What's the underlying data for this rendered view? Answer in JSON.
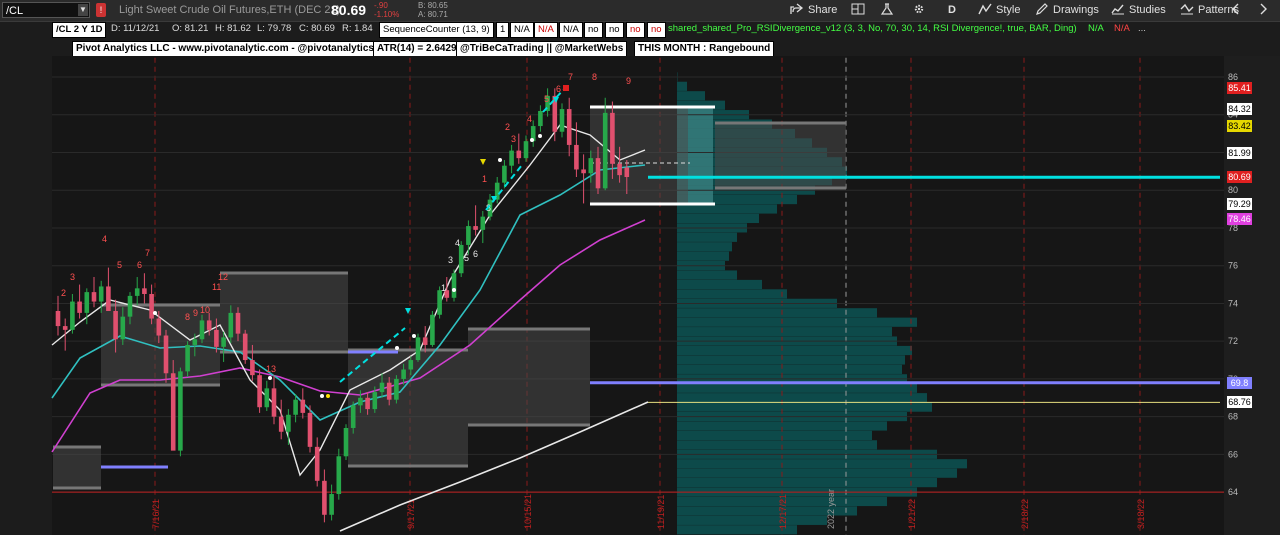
{
  "toolbar": {
    "symbol": "/CL",
    "description": "Light Sweet Crude Oil Futures,ETH (DEC 21)",
    "last": "80.69",
    "change_net": "-.90",
    "change_pct": "-1.10%",
    "bid": "B: 80.65",
    "ask": "A: 80.71",
    "share": "Share",
    "style": "Style",
    "drawings": "Drawings",
    "studies": "Studies",
    "patterns": "Patterns",
    "period": "D"
  },
  "header": {
    "period_label": "/CL 2 Y 1D",
    "date": "D: 11/12/21",
    "open": "O: 81.21",
    "high": "H: 81.62",
    "low": "L: 79.78",
    "close": "C: 80.69",
    "range": "R: 1.84",
    "seq_counter": "SequenceCounter (13, 9)",
    "seq_1": "1",
    "na1": "N/A",
    "na2": "N/A",
    "na3": "N/A",
    "no1": "no",
    "no2": "no",
    "no3": "no",
    "no4": "no",
    "rsi_study": "shared_shared_Pro_RSIDivergence_v12 (3, 3, No, 70, 30, 14, RSI Divergence!, true, BAR, Ding)",
    "rsi_na1": "N/A",
    "rsi_na2": "N/A",
    "ellipsis": "..."
  },
  "labels": {
    "brand": "Pivot Analytics LLC - www.pivotanalytic.com - @pivotanalytics",
    "atr": "ATR(14) = 2.6429",
    "social": "@TriBeCaTrading || @MarketWebs",
    "month": "THIS MONTH : Rangebound"
  },
  "price_axis": {
    "ticks": [
      "86",
      "84",
      "82",
      "80",
      "78",
      "76",
      "74",
      "72",
      "70",
      "68",
      "66",
      "64"
    ],
    "markers": [
      {
        "label": "85.41",
        "color": "#e02020"
      },
      {
        "label": "84.32",
        "color": "#ffffff"
      },
      {
        "label": "83.42",
        "color": "#e6d800"
      },
      {
        "label": "81.99",
        "color": "#ffffff"
      },
      {
        "label": "80.69",
        "color": "#e02020"
      },
      {
        "label": "79.29",
        "color": "#ffffff"
      },
      {
        "label": "78.46",
        "color": "#e040e0"
      },
      {
        "label": "69.8",
        "color": "#8080ff"
      },
      {
        "label": "68.76",
        "color": "#ffffff"
      }
    ]
  },
  "date_labels": [
    "7/16/21",
    "9/17/21",
    "10/15/21",
    "11/19/21",
    "12/17/21",
    "2022 year",
    "1/21/22",
    "2/18/22",
    "3/18/22"
  ],
  "sequence_marks": {
    "green": [
      "1",
      "2",
      "3",
      "4",
      "5",
      "6",
      "7",
      "8",
      "9"
    ],
    "red": [
      "2",
      "3",
      "4",
      "5",
      "6",
      "7",
      "8",
      "9",
      "10",
      "11",
      "12",
      "13"
    ]
  },
  "chart_data": {
    "type": "candlestick",
    "ylim": [
      62,
      87.5
    ],
    "horizontal_lines": [
      {
        "value": 64,
        "color": "#c02020"
      },
      {
        "value": 80.69,
        "color": "#00e0e0"
      },
      {
        "value": 69.8,
        "color": "#8080ff"
      }
    ],
    "candles": [
      [
        73.6,
        74.4,
        72.3,
        72.8
      ],
      [
        72.8,
        73.2,
        71.5,
        72.6
      ],
      [
        72.6,
        74.5,
        72.4,
        74.1
      ],
      [
        74.1,
        75.0,
        73.2,
        73.5
      ],
      [
        73.5,
        74.8,
        72.9,
        74.6
      ],
      [
        74.6,
        75.4,
        73.8,
        74.1
      ],
      [
        74.1,
        75.2,
        73.5,
        74.9
      ],
      [
        74.9,
        75.9,
        74.2,
        73.6
      ],
      [
        73.6,
        74.2,
        71.4,
        72.1
      ],
      [
        72.1,
        73.8,
        71.8,
        73.3
      ],
      [
        73.3,
        74.6,
        72.9,
        74.4
      ],
      [
        74.4,
        75.4,
        73.9,
        74.8
      ],
      [
        74.8,
        75.6,
        74.0,
        74.5
      ],
      [
        74.5,
        75.0,
        72.9,
        73.2
      ],
      [
        73.2,
        73.6,
        71.9,
        72.3
      ],
      [
        72.3,
        72.6,
        69.8,
        70.3
      ],
      [
        70.3,
        71.0,
        67.0,
        66.2
      ],
      [
        66.2,
        70.6,
        65.9,
        70.4
      ],
      [
        70.4,
        72.0,
        70.1,
        71.8
      ],
      [
        71.8,
        72.4,
        71.2,
        72.1
      ],
      [
        72.1,
        73.4,
        71.9,
        73.1
      ],
      [
        73.1,
        73.5,
        72.3,
        72.6
      ],
      [
        72.6,
        73.2,
        71.4,
        71.7
      ],
      [
        71.7,
        72.5,
        70.9,
        72.2
      ],
      [
        72.2,
        73.9,
        71.9,
        73.5
      ],
      [
        73.5,
        73.8,
        72.0,
        72.4
      ],
      [
        72.4,
        72.6,
        70.8,
        71.0
      ],
      [
        71.0,
        71.8,
        69.9,
        70.2
      ],
      [
        70.2,
        70.5,
        68.2,
        68.5
      ],
      [
        68.5,
        69.9,
        68.3,
        69.5
      ],
      [
        69.5,
        70.2,
        67.6,
        68.0
      ],
      [
        68.0,
        68.9,
        66.8,
        67.2
      ],
      [
        67.2,
        68.4,
        66.5,
        68.1
      ],
      [
        68.1,
        69.2,
        67.7,
        68.9
      ],
      [
        68.9,
        69.5,
        67.9,
        68.2
      ],
      [
        68.2,
        68.6,
        66.1,
        66.4
      ],
      [
        66.4,
        66.9,
        64.3,
        64.6
      ],
      [
        64.6,
        65.2,
        62.4,
        62.8
      ],
      [
        62.8,
        64.4,
        62.5,
        63.9
      ],
      [
        63.9,
        66.3,
        63.6,
        65.9
      ],
      [
        65.9,
        67.6,
        65.7,
        67.4
      ],
      [
        67.4,
        68.8,
        67.1,
        68.6
      ],
      [
        68.6,
        69.4,
        68.2,
        69.0
      ],
      [
        69.0,
        69.3,
        68.1,
        68.4
      ],
      [
        68.4,
        69.6,
        68.2,
        69.3
      ],
      [
        69.3,
        70.3,
        69.0,
        69.8
      ],
      [
        69.8,
        70.1,
        68.6,
        68.9
      ],
      [
        68.9,
        70.2,
        68.7,
        70.0
      ],
      [
        70.0,
        70.8,
        69.7,
        70.5
      ],
      [
        70.5,
        71.2,
        70.2,
        71.0
      ],
      [
        71.0,
        72.4,
        70.9,
        72.2
      ],
      [
        72.2,
        72.8,
        71.4,
        71.8
      ],
      [
        71.8,
        73.6,
        71.7,
        73.4
      ],
      [
        73.4,
        74.9,
        73.2,
        74.7
      ],
      [
        74.7,
        75.4,
        74.1,
        74.3
      ],
      [
        74.3,
        75.8,
        74.1,
        75.6
      ],
      [
        75.6,
        77.3,
        75.4,
        77.1
      ],
      [
        77.1,
        78.4,
        76.6,
        78.1
      ],
      [
        78.1,
        79.2,
        77.6,
        77.9
      ],
      [
        77.9,
        78.9,
        77.2,
        78.6
      ],
      [
        78.6,
        79.8,
        78.4,
        79.5
      ],
      [
        79.5,
        80.7,
        79.3,
        80.4
      ],
      [
        80.4,
        81.6,
        80.1,
        81.3
      ],
      [
        81.3,
        82.4,
        80.9,
        82.1
      ],
      [
        82.1,
        83.0,
        81.4,
        81.7
      ],
      [
        81.7,
        82.9,
        81.5,
        82.6
      ],
      [
        82.6,
        83.7,
        82.3,
        83.4
      ],
      [
        83.4,
        84.5,
        83.1,
        84.2
      ],
      [
        84.2,
        85.4,
        83.9,
        85.0
      ],
      [
        85.0,
        85.4,
        82.6,
        83.1
      ],
      [
        83.1,
        84.6,
        82.8,
        84.3
      ],
      [
        84.3,
        84.9,
        81.8,
        82.4
      ],
      [
        82.4,
        83.6,
        80.7,
        81.1
      ],
      [
        81.1,
        81.9,
        79.3,
        80.9
      ],
      [
        80.9,
        82.1,
        80.4,
        81.7
      ],
      [
        81.7,
        82.3,
        79.8,
        80.1
      ],
      [
        80.1,
        84.9,
        80.0,
        84.1
      ],
      [
        84.1,
        84.7,
        80.6,
        81.4
      ],
      [
        81.4,
        82.3,
        80.4,
        80.8
      ],
      [
        81.2,
        81.6,
        79.8,
        80.7
      ]
    ]
  }
}
